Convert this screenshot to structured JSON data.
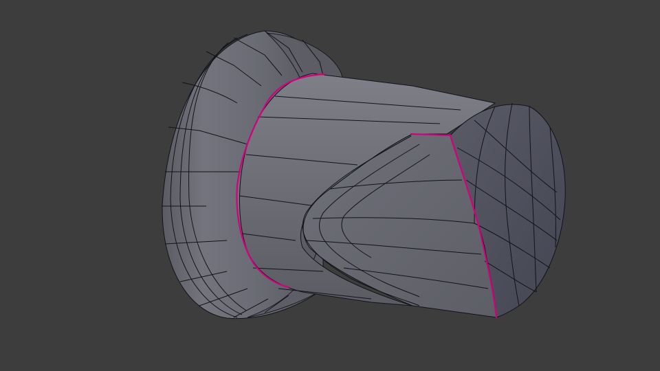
{
  "viewport": {
    "background": "#3d3d3d",
    "mode": "edit-mode",
    "shading": "solid"
  },
  "mesh": {
    "object": "cylinder-with-flange",
    "face_color_lit": "#8a8b93",
    "face_color_mid": "#6c6d76",
    "face_color_dark": "#45464f",
    "edge_color": "#111318",
    "seam_color": "#d4007d",
    "seams_visible": true
  }
}
